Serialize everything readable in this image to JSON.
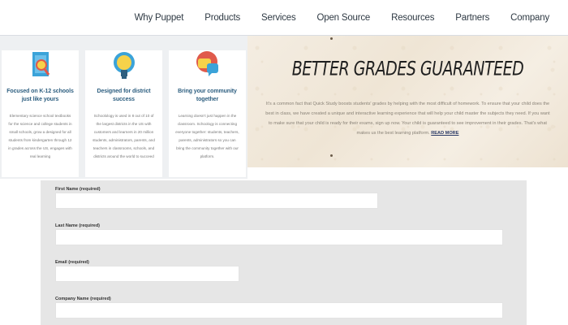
{
  "nav": {
    "items": [
      "Why Puppet",
      "Products",
      "Services",
      "Open Source",
      "Resources",
      "Partners",
      "Company"
    ]
  },
  "features": [
    {
      "icon": "magnifier-on-document-icon",
      "title": "Focused on K-12 schools just like yours",
      "body": "Elementary science school textbooks for the science and college students in small schools, grow a designed for all students from kindergarten through 12 in grades across the US, engages with real learning"
    },
    {
      "icon": "lightbulb-icon",
      "title": "Designed for district success",
      "body": "Schoolology is used in 8 out of 10 of the largest districts in the US with customers and learners in 20 million students, administrators, parents, and teachers in classrooms, schools, and districts around the world to succeed"
    },
    {
      "icon": "chat-bubbles-icon",
      "title": "Bring your community together",
      "body": "Learning doesn't just happen in the classroom. Schoology is connecting everyone together: students, teachers, parents, administrators so you can bring the community together with our platform."
    }
  ],
  "hero": {
    "title": "BETTER GRADES GUARANTEED",
    "text": "It's a common fact that Quick Study boosts students' grades by helping with the most difficult of homework. To ensure that your child does the best in class, we have created a unique and interactive learning experience that will help your child master the subjects they need. If you want to make sure that your child is ready for their exams, sign up now. Your child is guaranteed to see improvement in their grades. That's what makes us the best learning platform. Read more",
    "text_before": "It's a common fact that Quick Study boosts students' grades by helping with the most difficult of homework. To ensure that your child does the best in class, we have created a unique and interactive learning experience that will help your child master the subjects they need. If you want to make sure that your child is ready for their exams, sign up now. Your child is guaranteed to see improvement in their grades. That's what makes us the best learning platform.",
    "more_link": "READ MORE"
  },
  "form": {
    "first_name_label": "First Name (required)",
    "last_name_label": "Last Name (required)",
    "email_label": "Email (required)",
    "company_label": "Company Name (required)",
    "first_name_value": "",
    "last_name_value": "",
    "email_value": "",
    "company_value": ""
  },
  "colors": {
    "nav_text": "#2f3a44",
    "card_title": "#2e5f80",
    "hero_bg": "#f2eadc",
    "form_bg": "#e6e6e6",
    "link": "#2b3a66"
  }
}
